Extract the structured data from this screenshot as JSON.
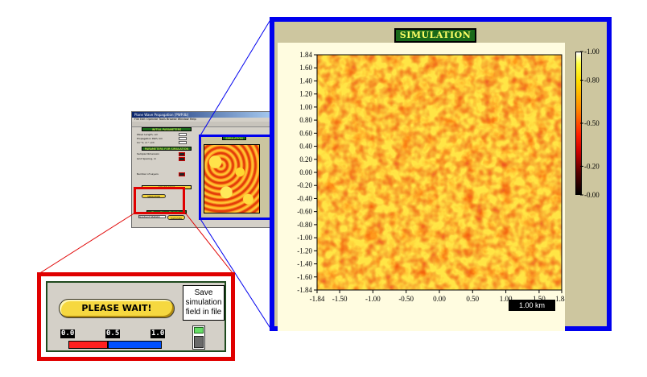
{
  "app": {
    "title": "Plane Wave Propagation [PWP.llb]",
    "menu": "File  Edit  Operate  Tools  Browse  Window  Help",
    "initial_parameters_header": "INITIAL PARAMETERS",
    "simulation_parameters_header": "PARAMETERS FOR SIMULATION",
    "generator_header": "GENERATOR",
    "statistics_header": "Plane Wave Statistics",
    "simulation_header": "SIMULATION",
    "wave_length_label": "Wave Length, um",
    "path_length_label": "Propagation Path, km",
    "cn2_label": "Cn^2, m^-2/3",
    "sample_dimension_label": "Sample Dimension",
    "grid_spacing_label": "Grid Spacing, m",
    "number_of_layers_label": "Number of Layers",
    "simulation_button": "SIMULATION",
    "statistic_type": "Gradient Statistic",
    "calculate_button": "Calculate"
  },
  "status_panel": {
    "wait_button_label": "PLEASE WAIT!",
    "save_label_lines": [
      "Save",
      "simulation",
      "field in file"
    ],
    "progress_ticks": [
      "0.0",
      "0.5",
      "1.0"
    ],
    "progress_value": 0.43,
    "save_switch_on": true
  },
  "simulation": {
    "title": "SIMULATION",
    "scale_label": "1.00   km",
    "y_ticks": [
      "1.84",
      "1.60",
      "1.40",
      "1.20",
      "1.00",
      "0.80",
      "0.60",
      "0.40",
      "0.20",
      "0.00",
      "-0.20",
      "-0.40",
      "-0.60",
      "-0.80",
      "-1.00",
      "-1.20",
      "-1.40",
      "-1.60",
      "-1.84"
    ],
    "x_ticks": [
      "-1.84",
      "-1.50",
      "-1.00",
      "-0.50",
      "0.00",
      "0.50",
      "1.00",
      "1.50",
      "1.84"
    ],
    "colorbar_ticks": [
      "-1.00",
      "-0.80",
      "-0.50",
      "-0.20",
      "-0.00"
    ],
    "colors": {
      "red": "#e8280c",
      "orange": "#ff9a1c",
      "yellow": "#ffe545"
    }
  },
  "colors": {
    "highlight_red": "#e00000",
    "highlight_blue": "#0000ee",
    "panel_green": "#1a6a1a",
    "button_yellow": "#f6d840"
  }
}
